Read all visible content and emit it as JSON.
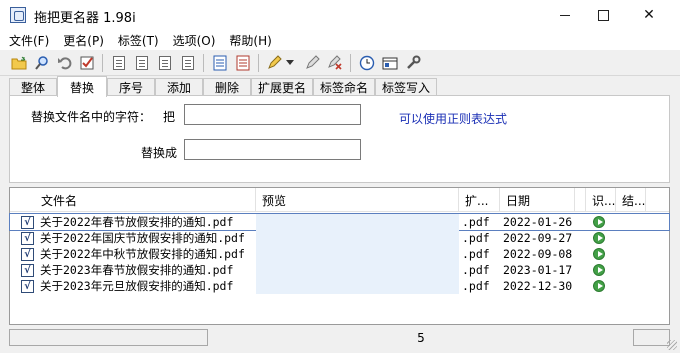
{
  "window": {
    "title": "拖把更名器 1.98i",
    "controls": {
      "minimize": "minimize-icon",
      "maximize": "maximize-icon",
      "close": "✕"
    }
  },
  "menu": [
    "文件(F)",
    "更名(P)",
    "标签(T)",
    "选项(O)",
    "帮助(H)"
  ],
  "toolbar": {
    "icons": [
      "open-folder-icon",
      "search-icon",
      "undo-icon",
      "check-icon",
      "move-down-icon",
      "move-up-icon",
      "move-top-icon",
      "move-bottom-icon",
      "document-icon",
      "document-list-icon",
      "pen-icon",
      "dropdown-arrow-icon",
      "clear-tag-icon",
      "delete-tag-icon",
      "clock-icon",
      "info-icon",
      "tools-icon"
    ]
  },
  "tabs": [
    "整体",
    "替换",
    "序号",
    "添加",
    "删除",
    "扩展更名",
    "标签命名",
    "标签写入"
  ],
  "active_tab": "替换",
  "replace_panel": {
    "find_label": "替换文件名中的字符：",
    "find_label_suffix": "把",
    "find_value": "",
    "replace_label": "替换成",
    "replace_value": "",
    "regex_link": "可以使用正则表达式"
  },
  "list": {
    "columns": [
      "文件名",
      "预览",
      "扩...",
      "日期",
      "识...",
      "结..."
    ],
    "rows": [
      {
        "checked": true,
        "name": "关于2022年春节放假安排的通知.pdf",
        "preview": "",
        "ext": ".pdf",
        "date": "2022-01-26",
        "status": "play-icon",
        "result": ""
      },
      {
        "checked": true,
        "name": "关于2022年国庆节放假安排的通知.pdf",
        "preview": "",
        "ext": ".pdf",
        "date": "2022-09-27",
        "status": "play-icon",
        "result": ""
      },
      {
        "checked": true,
        "name": "关于2022年中秋节放假安排的通知.pdf",
        "preview": "",
        "ext": ".pdf",
        "date": "2022-09-08",
        "status": "play-icon",
        "result": ""
      },
      {
        "checked": true,
        "name": "关于2023年春节放假安排的通知.pdf",
        "preview": "",
        "ext": ".pdf",
        "date": "2023-01-17",
        "status": "play-icon",
        "result": ""
      },
      {
        "checked": true,
        "name": "关于2023年元旦放假安排的通知.pdf",
        "preview": "",
        "ext": ".pdf",
        "date": "2022-12-30",
        "status": "play-icon",
        "result": ""
      }
    ],
    "check_mark": "√"
  },
  "statusbar": {
    "left": "",
    "count": "5",
    "right": ""
  }
}
